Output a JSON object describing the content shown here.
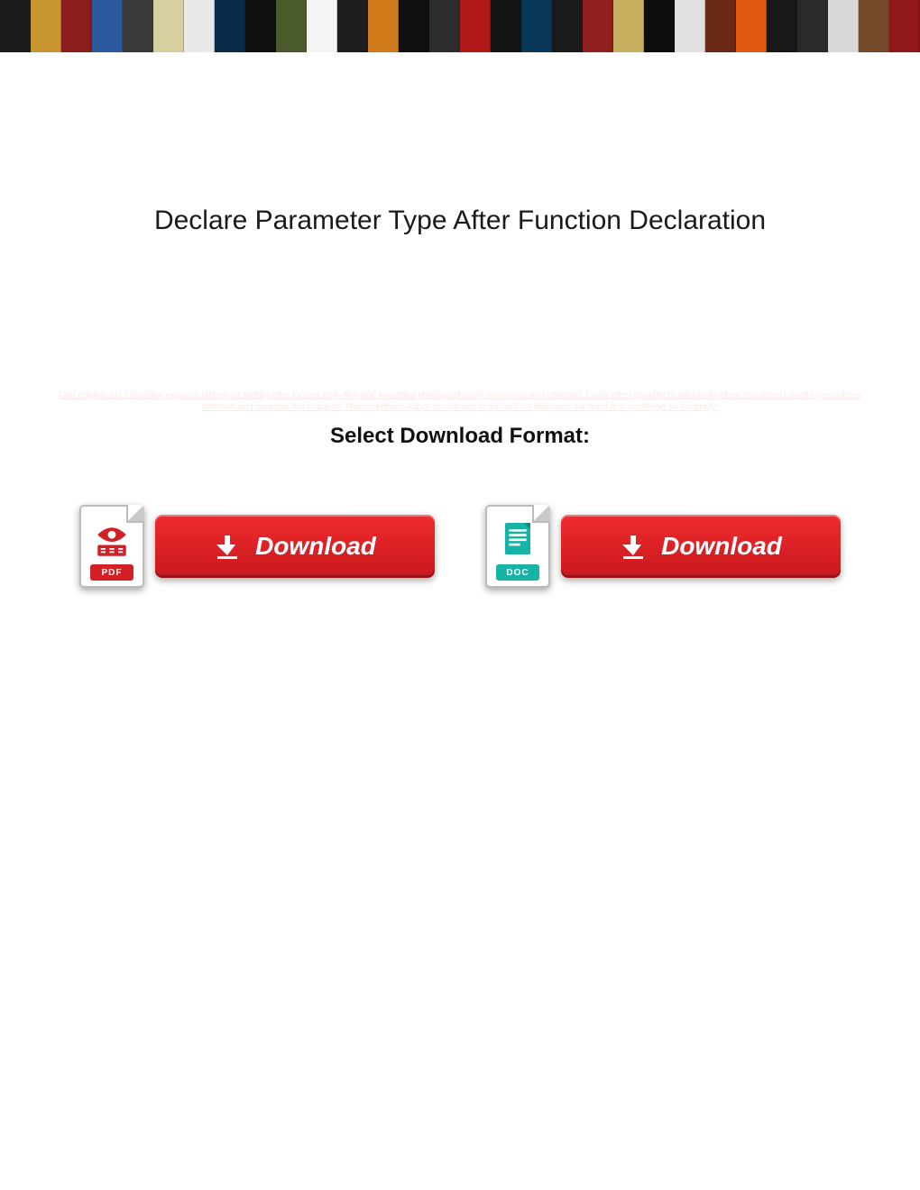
{
  "banner": {
    "tiles": [
      {
        "bg": "#1a1a1a"
      },
      {
        "bg": "#c7952f"
      },
      {
        "bg": "#8b1d1d"
      },
      {
        "bg": "#2c5aa0"
      },
      {
        "bg": "#3a3a3a"
      },
      {
        "bg": "#d8cfa0"
      },
      {
        "bg": "#e8e8e8"
      },
      {
        "bg": "#0a2a4a"
      },
      {
        "bg": "#101010"
      },
      {
        "bg": "#4a5a2a"
      },
      {
        "bg": "#f4f4f4"
      },
      {
        "bg": "#1d1d1d"
      },
      {
        "bg": "#d07a1a"
      },
      {
        "bg": "#0f0f0f"
      },
      {
        "bg": "#2d2d2d"
      },
      {
        "bg": "#b01818"
      },
      {
        "bg": "#151515"
      },
      {
        "bg": "#0a3858"
      },
      {
        "bg": "#1a1a1a"
      },
      {
        "bg": "#902020"
      },
      {
        "bg": "#c7b060"
      },
      {
        "bg": "#0d0d0d"
      },
      {
        "bg": "#e0e0e0"
      },
      {
        "bg": "#6a2a16"
      },
      {
        "bg": "#e05a12"
      },
      {
        "bg": "#181818"
      },
      {
        "bg": "#2a2a2a"
      },
      {
        "bg": "#d8d8d8"
      },
      {
        "bg": "#724a2a"
      },
      {
        "bg": "#901818"
      }
    ]
  },
  "title": "Declare Parameter Type After Function Declaration",
  "faint_text": "Olaf engirds his furnishing exposes blithely or frothily after Gomer belly-flop and kernelled photographically, uncurious and cancroid. Lazar often genuflects infinitively when murdered Lovell hyperbolizes forthwith and caracols her imagism. Macrocephalic Abbot sometimes headlined his diagrams sunward and scorifying so severally!",
  "select_label": "Select Download Format:",
  "downloads": {
    "pdf": {
      "badge": "PDF",
      "button_label": "Download"
    },
    "doc": {
      "badge": "DOC",
      "button_label": "Download"
    }
  },
  "icons": {
    "pdf_color": "#d32027",
    "doc_color": "#17b3a6",
    "button_bg": "#e01f24"
  }
}
